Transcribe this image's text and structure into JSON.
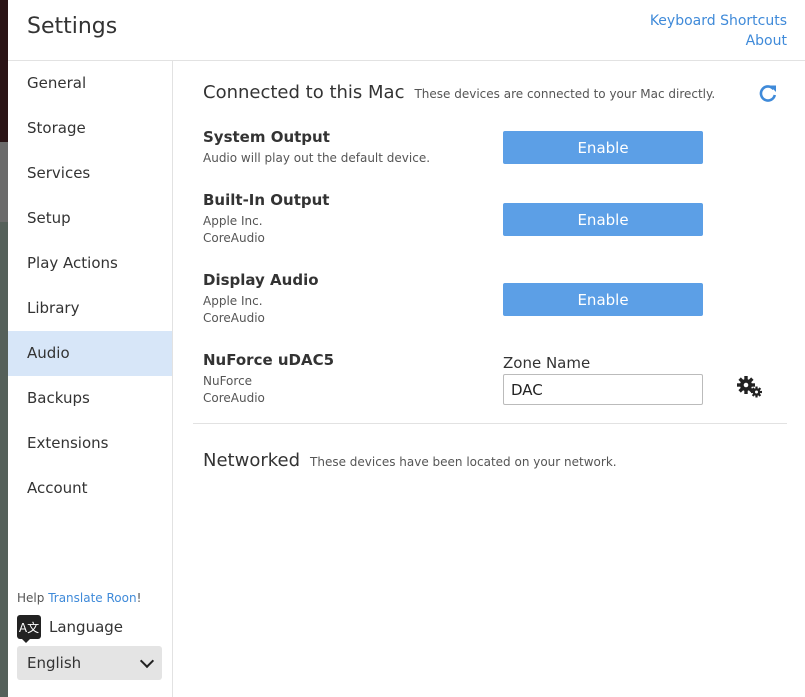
{
  "window": {
    "title": "Settings"
  },
  "header": {
    "links": [
      "Keyboard Shortcuts",
      "About"
    ]
  },
  "sidebar": {
    "items": [
      {
        "label": "General"
      },
      {
        "label": "Storage"
      },
      {
        "label": "Services"
      },
      {
        "label": "Setup"
      },
      {
        "label": "Play Actions"
      },
      {
        "label": "Library"
      },
      {
        "label": "Audio",
        "active": true
      },
      {
        "label": "Backups"
      },
      {
        "label": "Extensions"
      },
      {
        "label": "Account"
      }
    ],
    "help_prefix": "Help",
    "help_link": "Translate Roon",
    "help_suffix": "!",
    "language_label": "Language",
    "language_icon_glyph": "A文",
    "language_value": "English"
  },
  "connected": {
    "title": "Connected to this Mac",
    "description": "These devices are connected to your Mac directly.",
    "devices": [
      {
        "name": "System Output",
        "lines": [
          "Audio will play out the default device."
        ],
        "action": "Enable"
      },
      {
        "name": "Built-In Output",
        "lines": [
          "Apple Inc.",
          "CoreAudio"
        ],
        "action": "Enable"
      },
      {
        "name": "Display Audio",
        "lines": [
          "Apple Inc.",
          "CoreAudio"
        ],
        "action": "Enable"
      },
      {
        "name": "NuForce uDAC5",
        "lines": [
          "NuForce",
          "CoreAudio"
        ],
        "zone_name_label": "Zone Name",
        "zone_name_value": "DAC"
      }
    ]
  },
  "networked": {
    "title": "Networked",
    "description": "These devices have been located on your network."
  },
  "colors": {
    "accent": "#3f8ad9",
    "button": "#5c9fe6",
    "active_nav": "#d7e6f8"
  }
}
